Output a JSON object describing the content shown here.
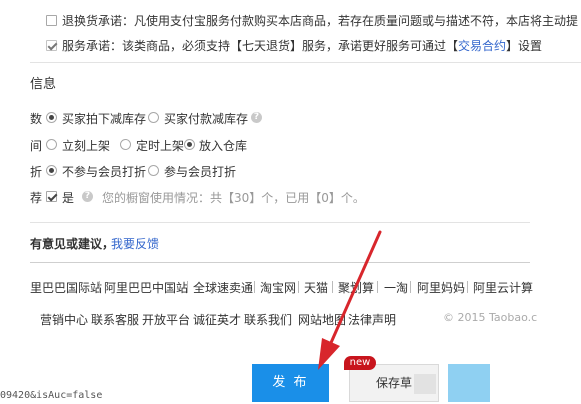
{
  "service": {
    "return_label": "退换货承诺：凡使用支付宝服务付款购买本店商品，若存在质量问题或与描述不符，本店将主动提",
    "commitment_prefix": "服务承诺：该类商品，必须支持【七天退货】服务，承诺更好服务可通过【",
    "commitment_link": "交易合约",
    "commitment_suffix": "】设置"
  },
  "section_title": "信息",
  "inventory": {
    "label_fragment": "数",
    "options": [
      "买家拍下减库存",
      "买家付款减库存"
    ],
    "selected": 0
  },
  "listing": {
    "label_fragment": "间",
    "options": [
      "立刻上架",
      "定时上架",
      "放入仓库"
    ],
    "selected": 2
  },
  "member_discount": {
    "label_fragment": "折",
    "options": [
      "不参与会员打折",
      "参与会员打折"
    ],
    "selected": 0
  },
  "showcase": {
    "label_fragment": "荐",
    "checkbox_label": "是",
    "usage_text": "您的橱窗使用情况：共【30】个，已用【0】个。"
  },
  "feedback": {
    "text": "有意见或建议，",
    "link": "我要反馈"
  },
  "footer_links_1": [
    "里巴巴国际站",
    "阿里巴巴中国站",
    "全球速卖通",
    "淘宝网",
    "天猫",
    "聚划算",
    "一淘",
    "阿里妈妈",
    "阿里云计算"
  ],
  "footer_links_2": [
    "营销中心",
    "联系客服",
    "开放平台",
    "诚征英才",
    "联系我们",
    "网站地图",
    "法律声明"
  ],
  "copyright": "© 2015 Taobao.c",
  "status_url": "09420&isAuc=false",
  "buttons": {
    "publish": "发 布",
    "save_draft": "保存草",
    "new_badge": "new"
  }
}
